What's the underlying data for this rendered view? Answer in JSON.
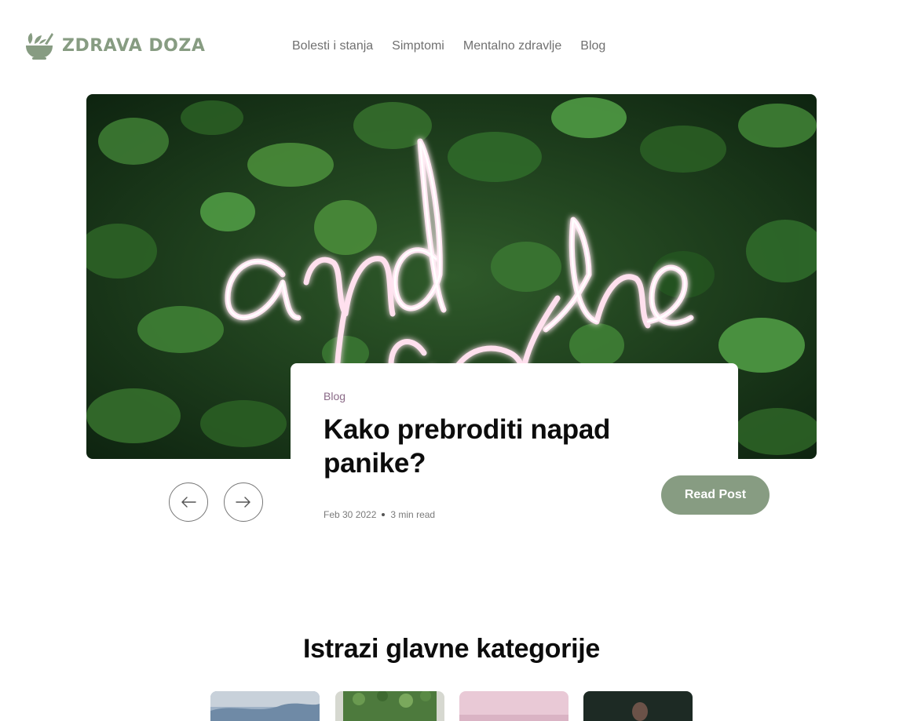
{
  "brand": {
    "name": "ZDRAVA DOZA",
    "color": "#879c82",
    "logo_icon": "mortar-pestle-leaves-icon"
  },
  "nav": {
    "items": [
      {
        "label": "Bolesti i stanja"
      },
      {
        "label": "Simptomi"
      },
      {
        "label": "Mentalno zdravlje"
      },
      {
        "label": "Blog"
      }
    ]
  },
  "hero": {
    "image": "neon sign 'and breathe' on green plant wall",
    "neon_text": "and breathe"
  },
  "featured_post": {
    "category": "Blog",
    "title": "Kako prebroditi napad panike?",
    "date": "Feb 30 2022",
    "read_time": "3 min read",
    "read_label": "Read Post"
  },
  "carousel": {
    "prev_icon": "arrow-left-icon",
    "next_icon": "arrow-right-icon"
  },
  "categories_section": {
    "title": "Istrazi glavne kategorije",
    "tiles": [
      {
        "image": "sky-landscape"
      },
      {
        "image": "green-plants"
      },
      {
        "image": "pink-scene"
      },
      {
        "image": "dark-portrait"
      }
    ]
  },
  "colors": {
    "accent": "#879c82",
    "category_text": "#8a6a87"
  }
}
